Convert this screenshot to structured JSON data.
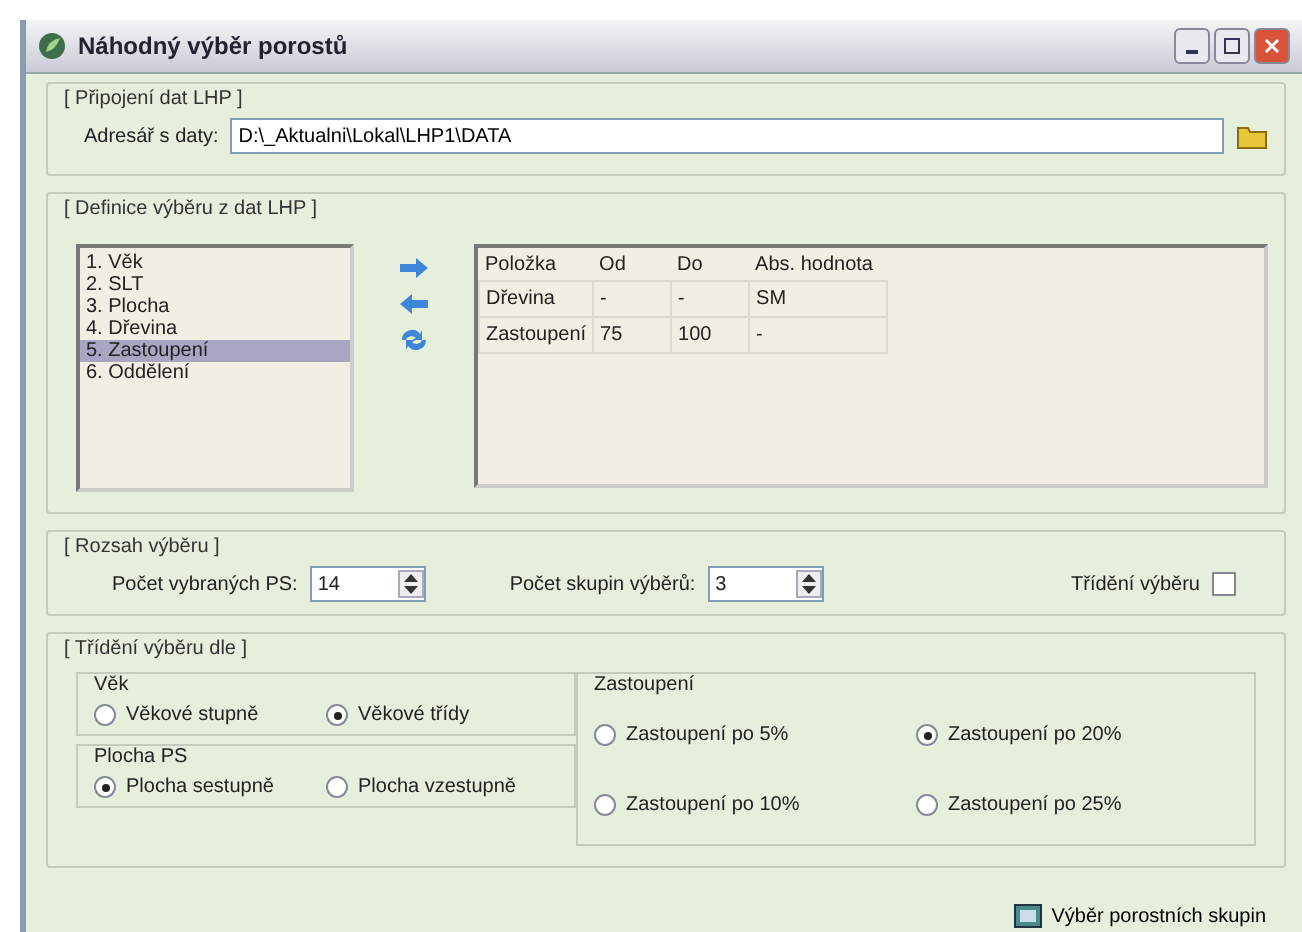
{
  "window": {
    "title": "Náhodný výběr porostů"
  },
  "connection": {
    "title": "[ Připojení dat LHP ]",
    "label": "Adresář s daty:",
    "value": "D:\\_Aktualni\\Lokal\\LHP1\\DATA"
  },
  "definition": {
    "title": "[ Definice výběru z dat LHP ]",
    "items": [
      {
        "label": "1. Věk",
        "selected": false
      },
      {
        "label": "2. SLT",
        "selected": false
      },
      {
        "label": "3. Plocha",
        "selected": false
      },
      {
        "label": "4. Dřevina",
        "selected": false
      },
      {
        "label": "5. Zastoupení",
        "selected": true
      },
      {
        "label": "6. Oddělení",
        "selected": false
      }
    ],
    "table": {
      "columns": [
        "Položka",
        "Od",
        "Do",
        "Abs. hodnota"
      ],
      "rows": [
        [
          "Dřevina",
          "-",
          "-",
          "SM"
        ],
        [
          "Zastoupení",
          "75",
          "100",
          "-"
        ]
      ]
    }
  },
  "range": {
    "title": "[ Rozsah výběru ]",
    "count_label": "Počet vybraných PS:",
    "count": "14",
    "groups_label": "Počet skupin výběrů:",
    "groups": "3",
    "sort_label": "Třídění výběru",
    "sort_checked": false
  },
  "sorting": {
    "title": "[ Třídění výběru dle ]",
    "groups": [
      {
        "title": "Věk",
        "options": [
          {
            "label": "Věkové stupně",
            "selected": false
          },
          {
            "label": "Věkové třídy",
            "selected": true
          }
        ]
      },
      {
        "title": "Plocha PS",
        "options": [
          {
            "label": "Plocha sestupně",
            "selected": true
          },
          {
            "label": "Plocha vzestupně",
            "selected": false
          }
        ]
      },
      {
        "title": "Zastoupení",
        "options": [
          {
            "label": "Zastoupení po 5%",
            "selected": false
          },
          {
            "label": "Zastoupení po 20%",
            "selected": true
          },
          {
            "label": "Zastoupení po 10%",
            "selected": false
          },
          {
            "label": "Zastoupení po 25%",
            "selected": false
          }
        ]
      }
    ]
  },
  "footer_button": "Výběr porostních skupin"
}
